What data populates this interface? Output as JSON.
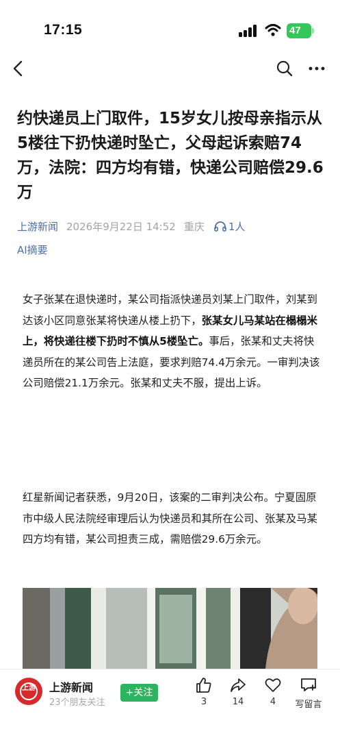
{
  "status_bar": {
    "time": "17:15",
    "battery": "47"
  },
  "nav": {
    "back_icon": "chevron-left-icon",
    "search_icon": "search-icon",
    "more_icon": "more-icon"
  },
  "article": {
    "title": "约快递员上门取件，15岁女儿按母亲指示从5楼往下扔快递时坠亡，父母起诉索赔74万，法院：四方均有错，快递公司赔偿29.6万",
    "source": "上游新闻",
    "date": "2026年9月22日 14:52",
    "location": "重庆",
    "listeners": "1人",
    "ai_summary": "AI摘要",
    "para1_a": "女子张某在退快递时，某公司指派快递员刘某上门取件，刘某到达该小区同意张某将快递从楼上扔下，",
    "para1_bold": "张某女儿马某站在榻榻米上，将快递往楼下扔时不慎从5楼坠亡。",
    "para1_b": "事后，张某和丈夫将快递员所在的某公司告上法庭，要求判赔74.4万余元。一审判决该公司赔偿21.1万余元。张某和丈夫不服，提出上诉。",
    "para2": "红星新闻记者获悉，9月20日，该案的二审判决公布。宁夏固原市中级人民法院经审理后认为快递员和其所在公司、张某及马某四方均有错，某公司担责三成，需赔偿29.6万余元。"
  },
  "bottom_bar": {
    "source_name": "上游新闻",
    "logo_text": "上游",
    "followers": "23个朋友关注",
    "follow_label": "+关注",
    "like_count": "3",
    "share_count": "14",
    "fav_count": "4",
    "comment_label": "写留言"
  },
  "colors": {
    "source_blue": "#4a6fa5",
    "follow_green": "#2eb360",
    "logo_red": "#d52b2b",
    "battery_green": "#34c759"
  }
}
